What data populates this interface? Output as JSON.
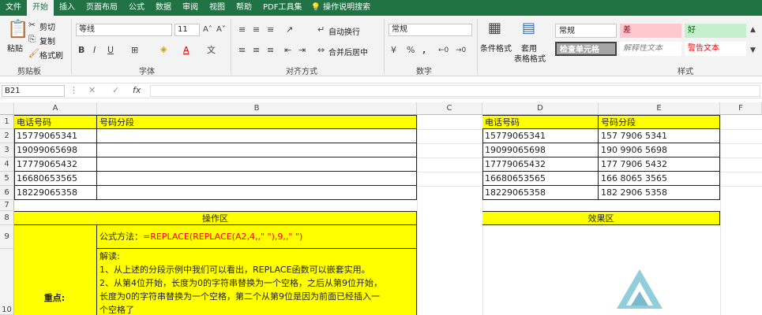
{
  "tabs": [
    "文件",
    "开始",
    "插入",
    "页面布局",
    "公式",
    "数据",
    "审阅",
    "视图",
    "帮助",
    "PDF工具集",
    "操作说明搜索"
  ],
  "clipboard": {
    "paste": "粘贴",
    "cut": "剪切",
    "copy": "复制",
    "format_painter": "格式刷",
    "group": "剪贴板"
  },
  "font": {
    "name": "等线",
    "size": "11",
    "group": "字体"
  },
  "alignment": {
    "wrap": "自动换行",
    "merge": "合并后居中",
    "group": "对齐方式"
  },
  "number": {
    "format": "常规",
    "group": "数字"
  },
  "styles": {
    "cond": "条件格式",
    "table1": "套用",
    "table2": "表格格式",
    "group": "样式",
    "cells": [
      {
        "label": "常规",
        "bg": "#ffffff"
      },
      {
        "label": "差",
        "bg": "#ffc7ce"
      },
      {
        "label": "好",
        "bg": "#c6efce"
      },
      {
        "label": "检查单元格",
        "bg": "#a5a5a5"
      },
      {
        "label": "解释性文本",
        "bg": "#ffffff"
      },
      {
        "label": "警告文本",
        "bg": "#ffffff"
      }
    ]
  },
  "formula_bar": {
    "name_box": "B21",
    "fx": "fx"
  },
  "columns": [
    "A",
    "B",
    "C",
    "D",
    "E",
    "F"
  ],
  "rows": [
    "1",
    "2",
    "3",
    "4",
    "5",
    "6",
    "7",
    "8",
    "9",
    "10"
  ],
  "table1": {
    "h1": "电话号码",
    "h2": "号码分段",
    "phones": [
      "15779065341",
      "19099065698",
      "17779065432",
      "16680653565",
      "18229065358"
    ]
  },
  "table2": {
    "h1": "电话号码",
    "h2": "号码分段",
    "phones": [
      "15779065341",
      "19099065698",
      "17779065432",
      "16680653565",
      "18229065358"
    ],
    "segs": [
      "157 7906 5341",
      "190 9906 5698",
      "177 7906 5432",
      "166 8065 3565",
      "182 2906 5358"
    ]
  },
  "operation_title": "操作区",
  "effect_title": "效果区",
  "formula_label": "公式方法：",
  "formula_text": "=REPLACE(REPLACE(A2,4,,\" \"),9,,\" \")",
  "key_label": "重点:",
  "explain": [
    "解读:",
    "1、从上述的分段示例中我们可以看出，REPLACE函数可以嵌套实用。",
    "2、从第4位开始，长度为0的字符串替换为一个空格，之后从第9位开始，",
    "长度为0的字符串替换为一个空格，第二个从第9位是因为前面已经插入一",
    "个空格了"
  ],
  "colors": {
    "ribbon_green": "#217346",
    "highlight": "#ffff00",
    "formula_red": "#ff0000"
  }
}
